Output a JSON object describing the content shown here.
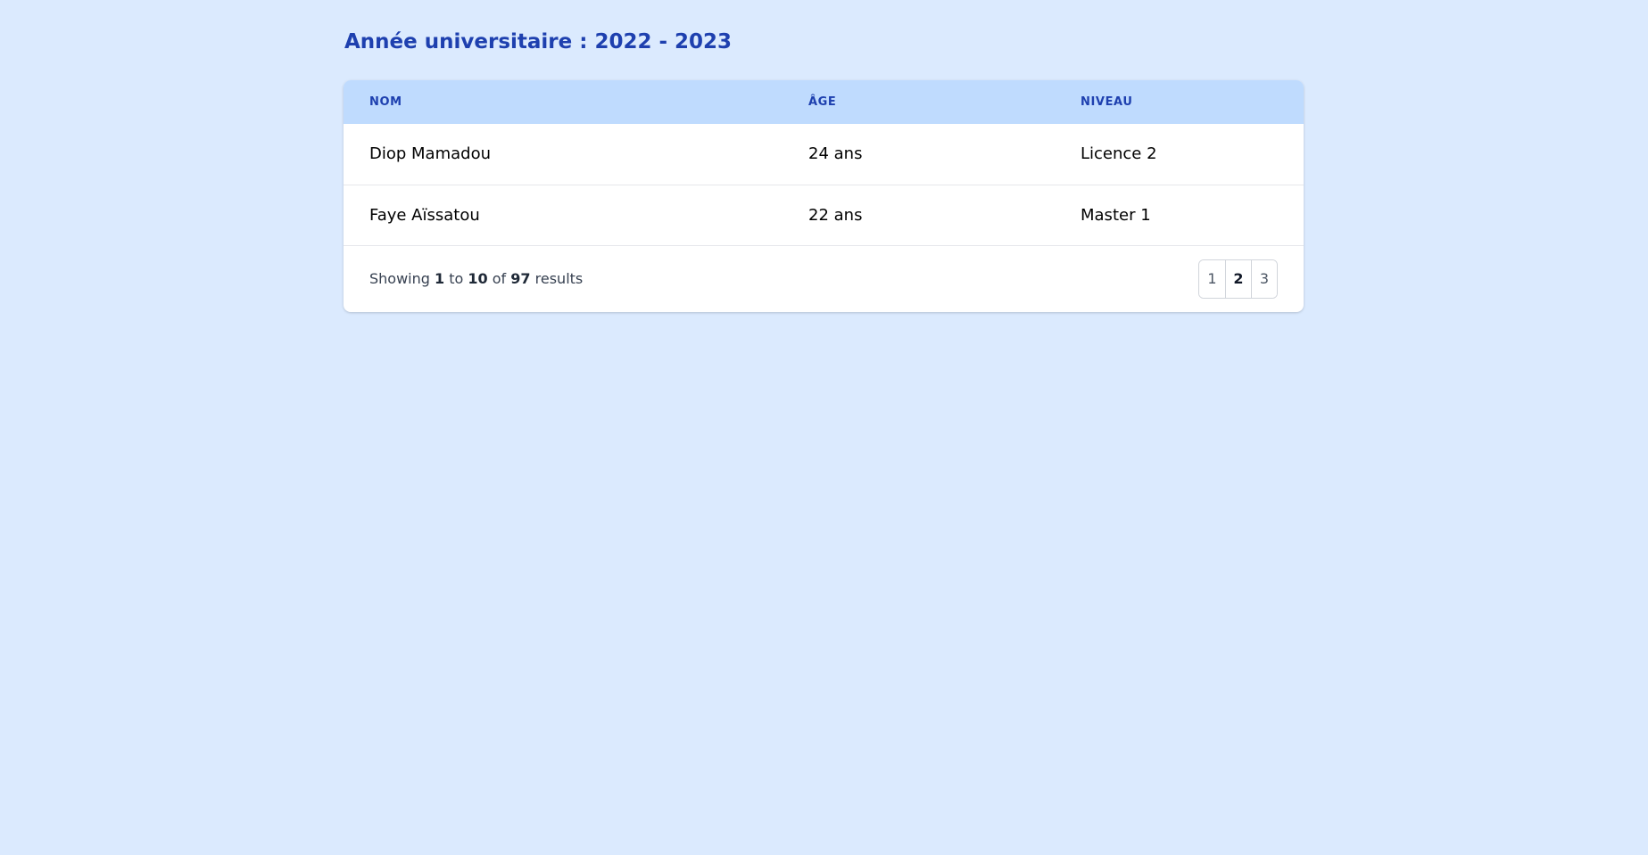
{
  "page": {
    "title": "Année universitaire : 2022 - 2023"
  },
  "table": {
    "headers": {
      "nom": "NOM",
      "age": "ÂGE",
      "niveau": "NIVEAU"
    },
    "rows": [
      {
        "nom": "Diop Mamadou",
        "age": "24 ans",
        "niveau": "Licence 2"
      },
      {
        "nom": "Faye Aïssatou",
        "age": "22 ans",
        "niveau": "Master 1"
      }
    ]
  },
  "footer": {
    "summary": {
      "prefix": "Showing",
      "from": "1",
      "to_word": "to",
      "to": "10",
      "of_word": "of",
      "total": "97",
      "suffix": "results"
    },
    "pagination": {
      "pages": [
        "1",
        "2",
        "3"
      ],
      "current": "2"
    }
  },
  "colors": {
    "background": "#dbeafe",
    "header_background": "#bfdbfe",
    "accent": "#1e40af"
  }
}
